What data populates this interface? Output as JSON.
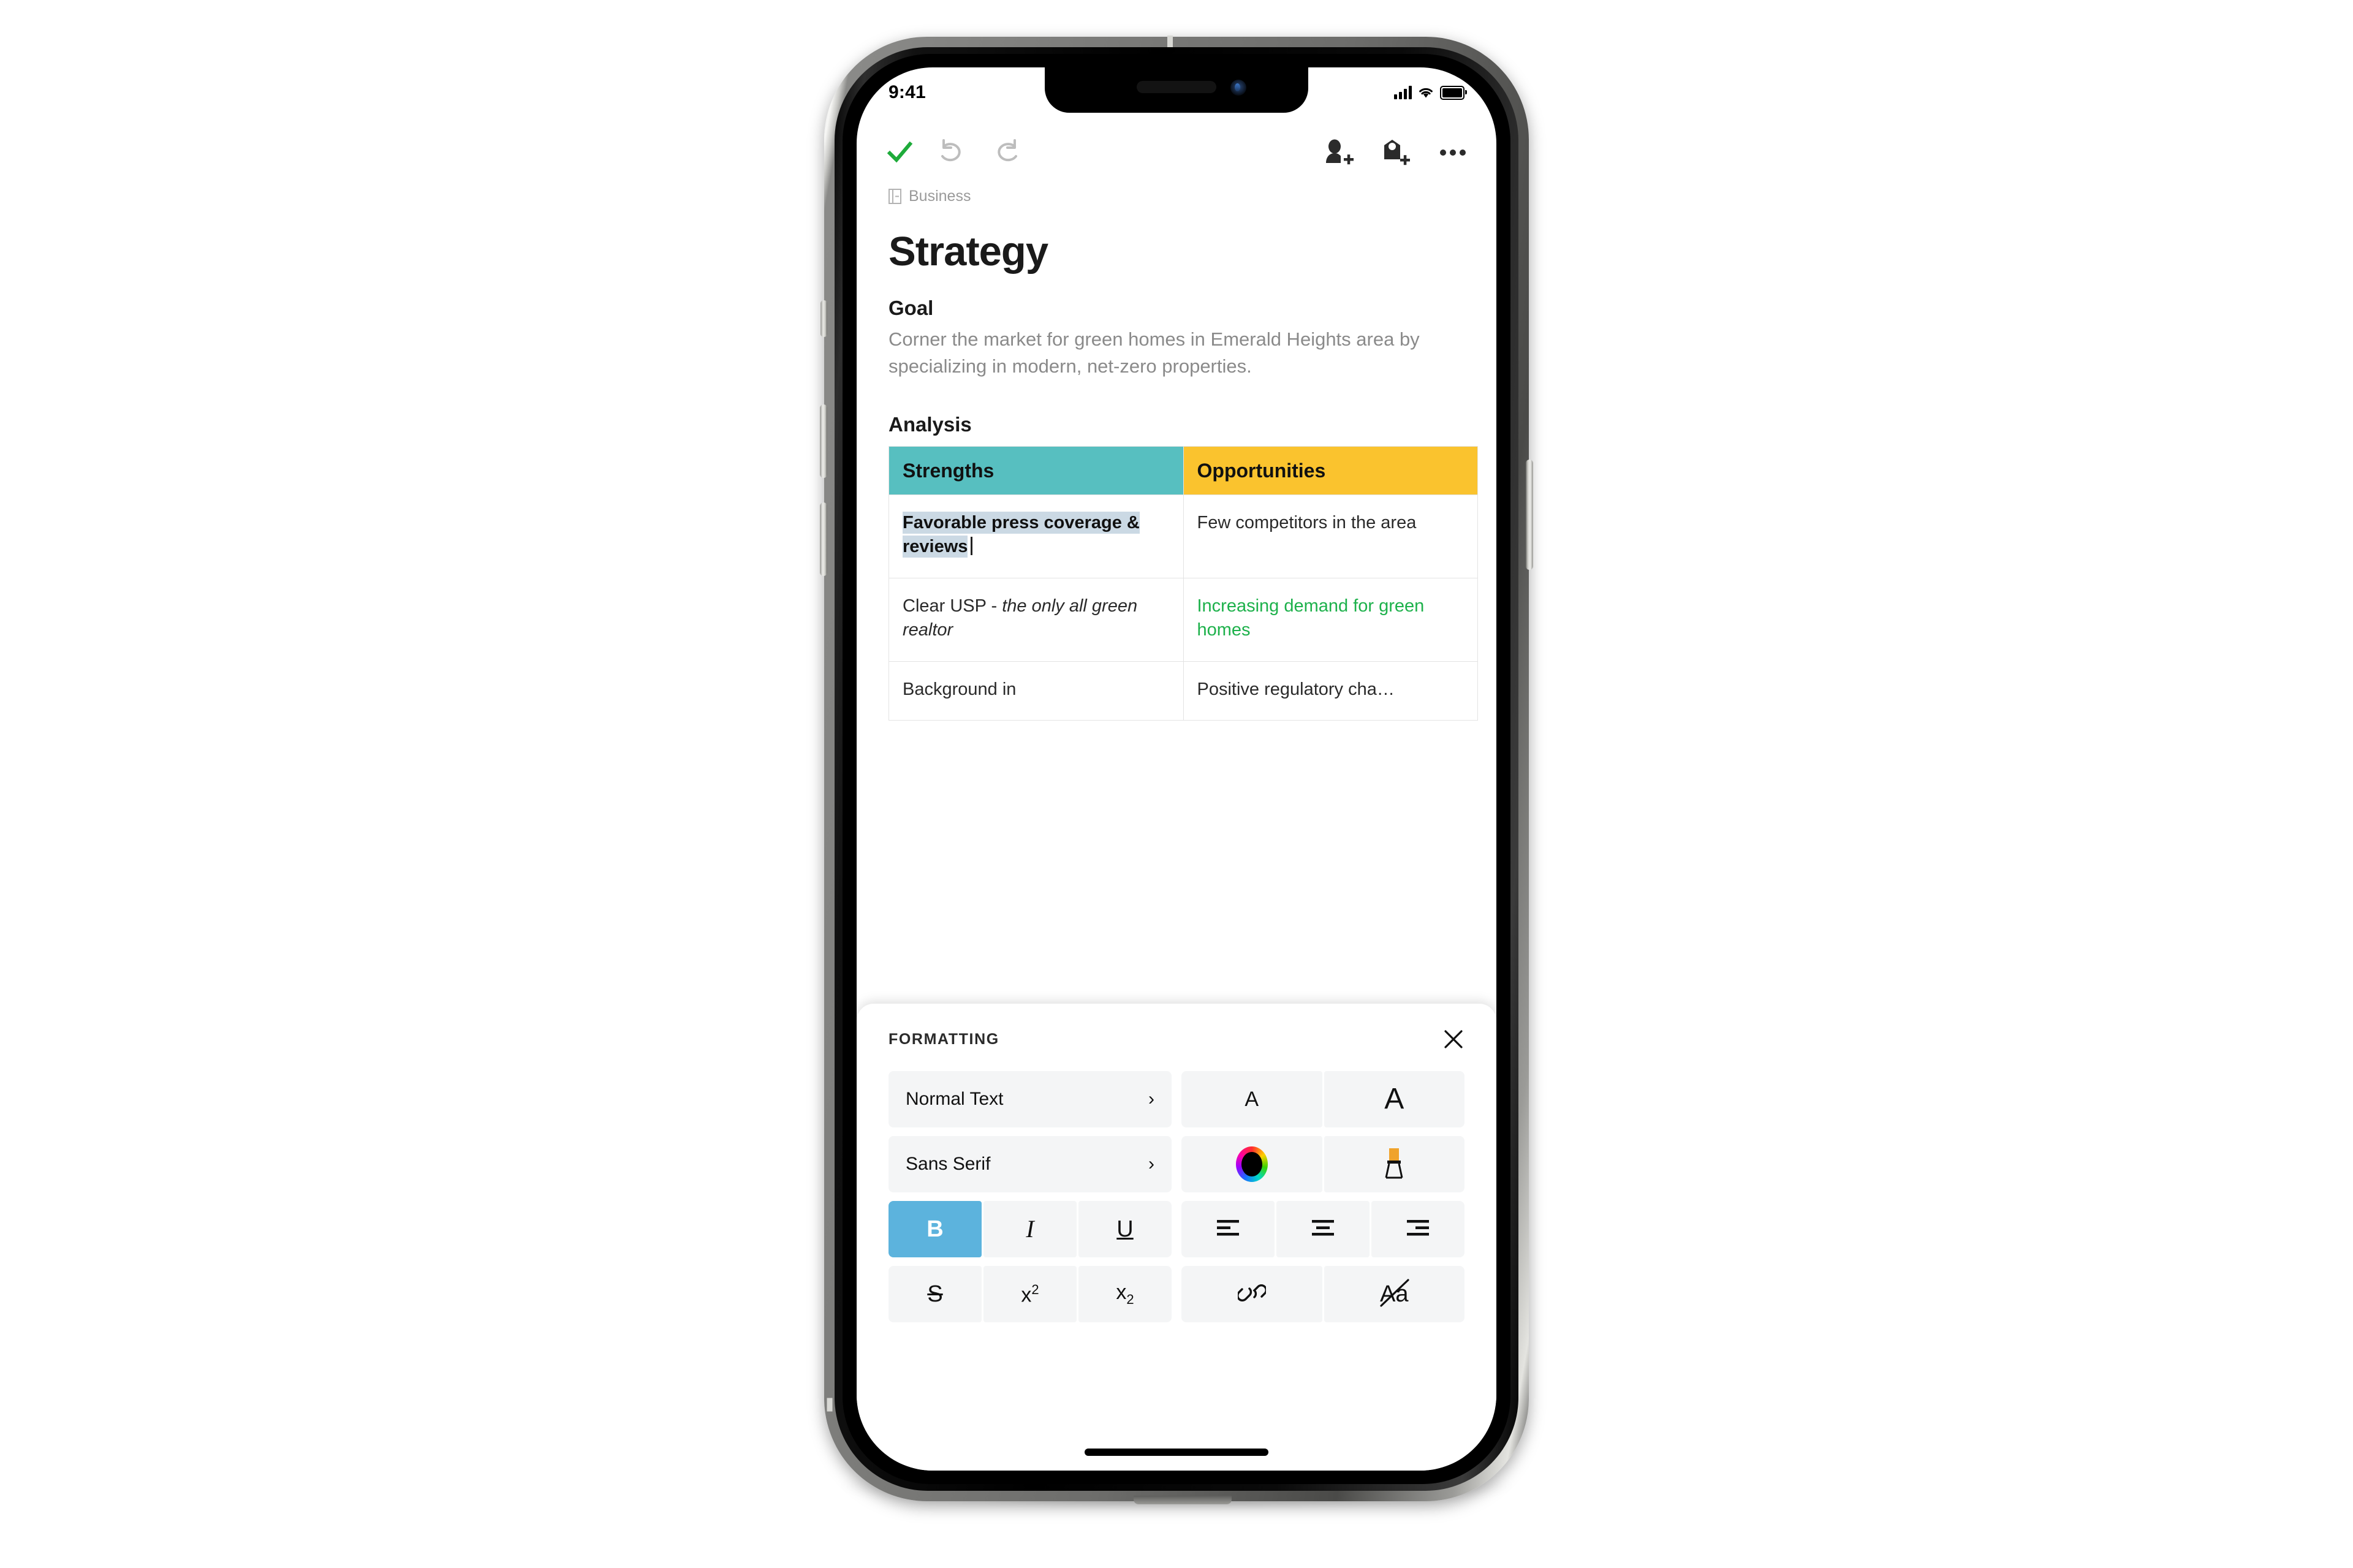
{
  "status_bar": {
    "time": "9:41",
    "signal_icon": "cellular-signal-icon",
    "wifi_icon": "wifi-icon",
    "battery_icon": "battery-full-icon"
  },
  "toolbar": {
    "done_label": "done-check",
    "undo_label": "undo",
    "redo_label": "redo",
    "add_person_label": "add-person",
    "add_tag_label": "add-tag",
    "more_label": "more-options"
  },
  "document": {
    "breadcrumb": "Business",
    "title": "Strategy",
    "goal_heading": "Goal",
    "goal_text": "Corner the market for green homes in Emerald Heights area by specializing in modern, net-zero properties.",
    "analysis_heading": "Analysis",
    "table": {
      "headers": [
        "Strengths",
        "Opportunities"
      ],
      "rows": [
        {
          "strengths": "Favorable press coverage & reviews",
          "strengths_selected": true,
          "opportunities": "Few competitors in the area"
        },
        {
          "strengths_prefix": "Clear USP - ",
          "strengths_italic": "the only all green realtor",
          "opportunities": "Increasing demand for green homes",
          "opportunities_green": true
        },
        {
          "strengths": "Background in",
          "opportunities": "Positive regulatory cha…"
        }
      ]
    }
  },
  "formatting_panel": {
    "title": "FORMATTING",
    "close_label": "×",
    "style_value": "Normal Text",
    "font_value": "Sans Serif",
    "chevron": "›",
    "buttons": {
      "decrease_font": "A",
      "increase_font": "A",
      "text_color": "color-wheel",
      "highlighter": "highlighter",
      "bold": "B",
      "italic": "I",
      "underline": "U",
      "align_left": "align-left",
      "align_center": "align-center",
      "align_right": "align-right",
      "strikethrough": "S",
      "superscript_base": "x",
      "superscript_sup": "2",
      "subscript_base": "x",
      "subscript_sub": "2",
      "link": "link",
      "clear_formatting": "Aa"
    },
    "active_buttons": [
      "bold"
    ]
  },
  "colors": {
    "strengths_header": "#57bfc0",
    "opportunities_header": "#fac32e",
    "selection_highlight": "#cbd9e4",
    "active_button": "#5cb3dd",
    "green_text": "#1db14b",
    "done_check": "#1eab3a",
    "panel_button_bg": "#f4f5f6"
  }
}
